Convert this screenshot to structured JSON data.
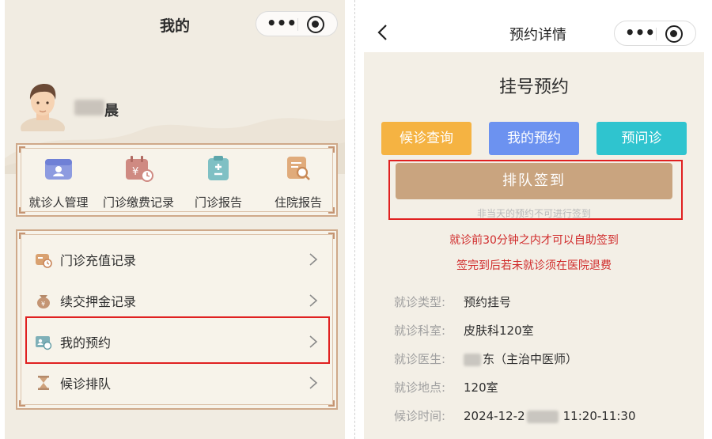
{
  "left": {
    "title": "我的",
    "capsule": {
      "more_icon": "more-dots-icon",
      "close_icon": "mini-program-close-icon"
    },
    "user": {
      "name_visible": "晨"
    },
    "grid": [
      {
        "label": "就诊人管理",
        "icon": "patient-card-icon",
        "color": "#7a8ad8"
      },
      {
        "label": "门诊缴费记录",
        "icon": "payment-calendar-icon",
        "color": "#c77a72"
      },
      {
        "label": "门诊报告",
        "icon": "clipboard-report-icon",
        "color": "#6fb3b8"
      },
      {
        "label": "住院报告",
        "icon": "document-search-icon",
        "color": "#d39b6a"
      }
    ],
    "list": [
      {
        "label": "门诊充值记录",
        "icon": "recharge-record-icon"
      },
      {
        "label": "续交押金记录",
        "icon": "deposit-bag-icon"
      },
      {
        "label": "我的预约",
        "icon": "appointment-card-icon"
      },
      {
        "label": "候诊排队",
        "icon": "hourglass-icon"
      }
    ]
  },
  "right": {
    "title": "预约详情",
    "back_icon": "back-chevron-icon",
    "section_title": "挂号预约",
    "buttons": {
      "wait_query": "候诊查询",
      "my_appointment": "我的预约",
      "pre_consult": "预问诊"
    },
    "checkin": {
      "label": "排队签到",
      "note": "非当天的预约不可进行签到"
    },
    "warnings": [
      "就诊前30分钟之内才可以自助签到",
      "签完到后若未就诊须在医院退费"
    ],
    "info": {
      "type": {
        "label": "就诊类型:",
        "value": "预约挂号"
      },
      "dept": {
        "label": "就诊科室:",
        "value": "皮肤科120室"
      },
      "doctor": {
        "label": "就诊医生:",
        "value": "东（主治中医师）"
      },
      "location": {
        "label": "就诊地点:",
        "value": "120室"
      },
      "time": {
        "label": "候诊时间:",
        "value_prefix": "2024-12-2",
        "value_suffix": "11:20-11:30"
      }
    }
  },
  "colors": {
    "gold": "#c9a47f",
    "frame": "#cfa98a",
    "warn": "#d02b2b",
    "highlight": "#e02020",
    "btn_wait": "#f5b342",
    "btn_mine": "#6c92f0",
    "btn_pre": "#2fc4cf"
  }
}
